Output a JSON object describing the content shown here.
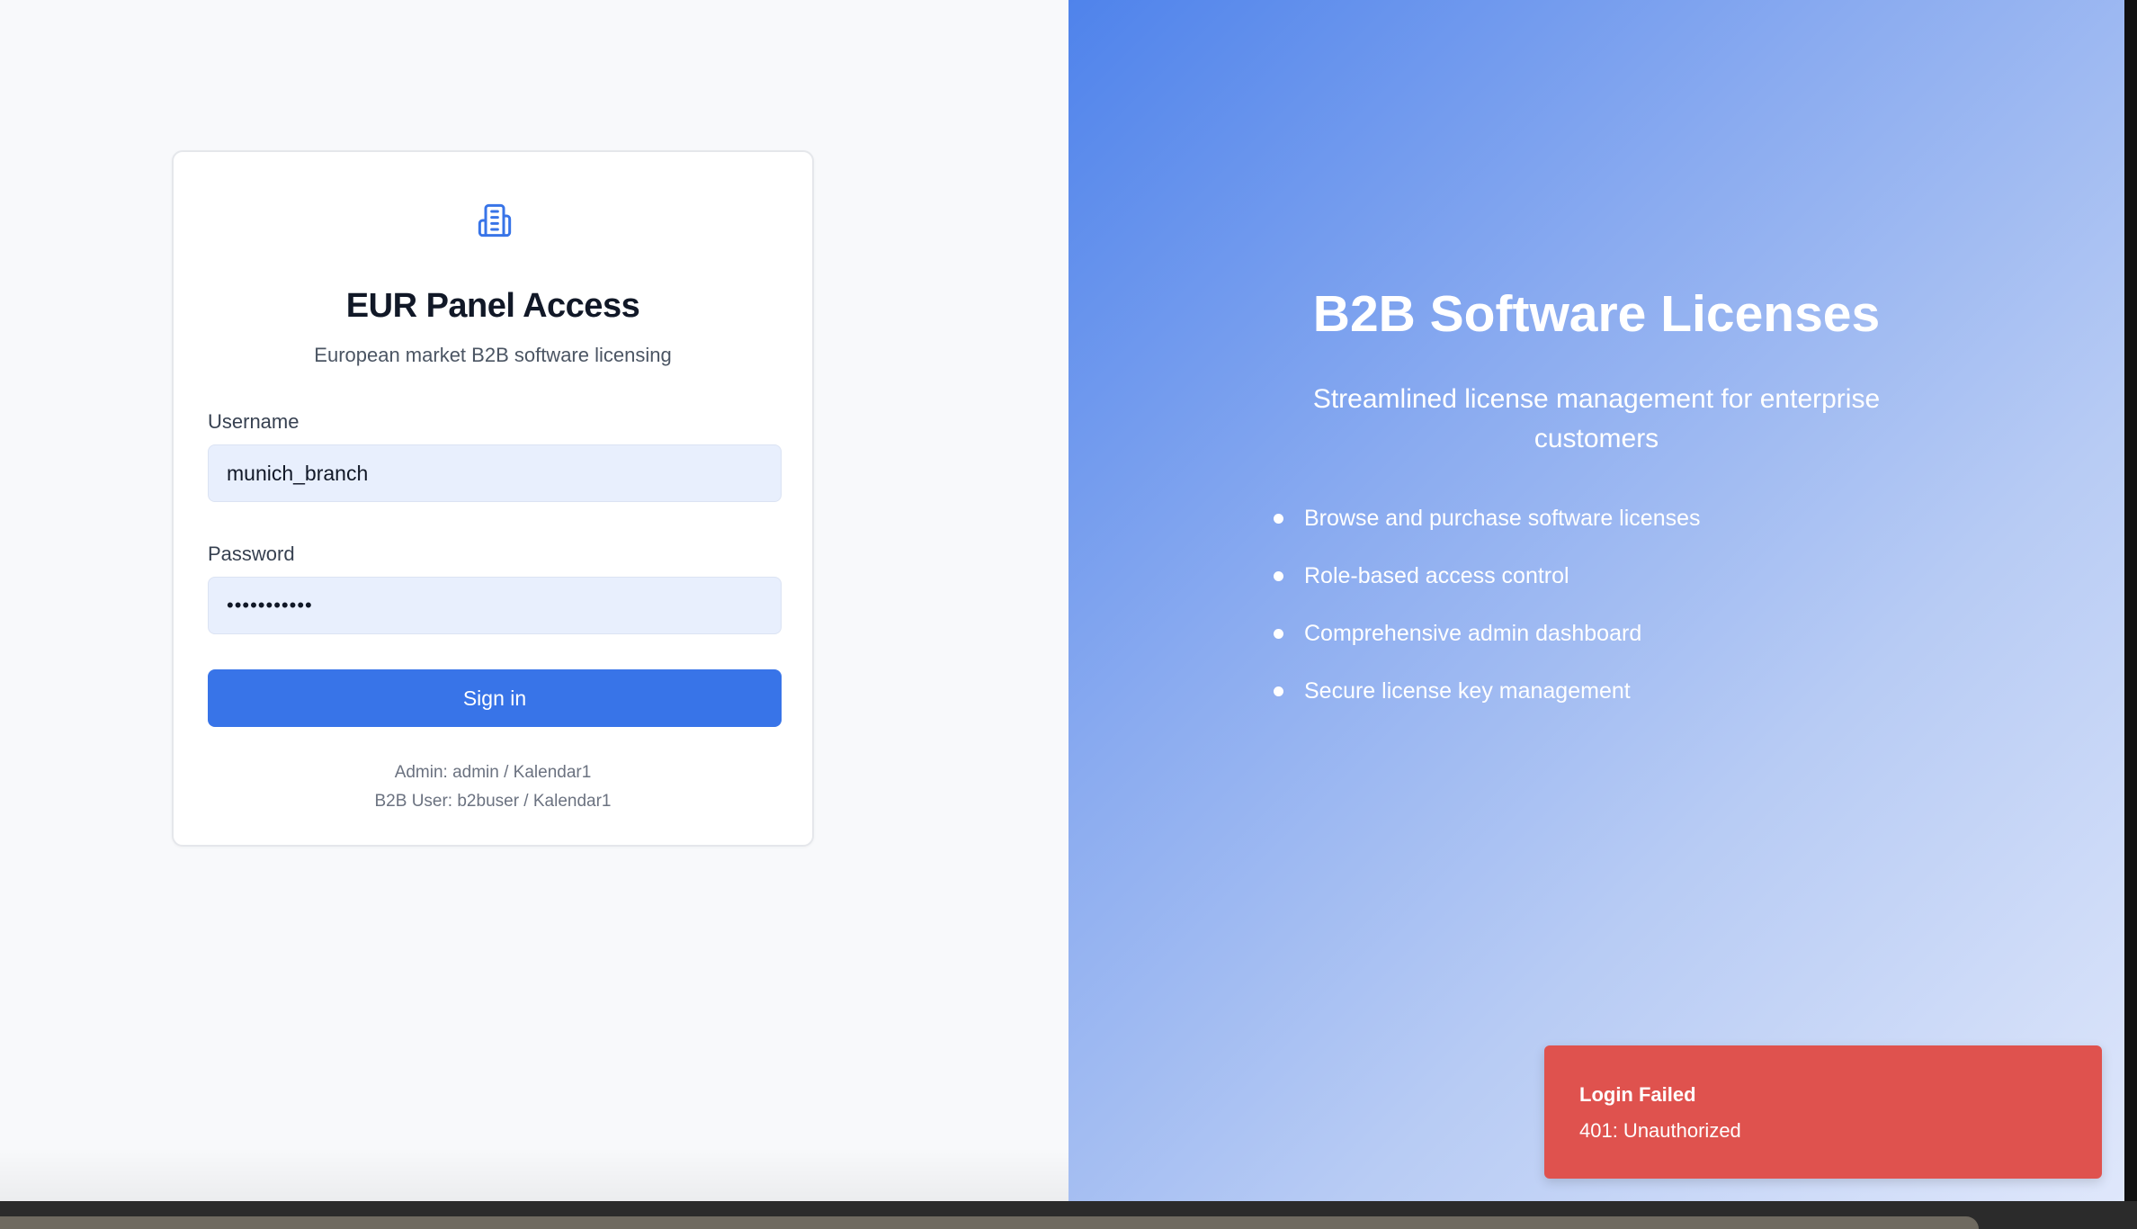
{
  "login_card": {
    "icon": "building-icon",
    "title": "EUR Panel Access",
    "subtitle": "European market B2B software licensing",
    "username_label": "Username",
    "username_value": "munich_branch",
    "password_label": "Password",
    "password_value": "•••••••••••",
    "signin_label": "Sign in",
    "hints": [
      "Admin: admin / Kalendar1",
      "B2B User: b2buser / Kalendar1"
    ]
  },
  "hero": {
    "title": "B2B Software Licenses",
    "subtitle": "Streamlined license management for enterprise customers",
    "features": [
      "Browse and purchase software licenses",
      "Role-based access control",
      "Comprehensive admin dashboard",
      "Secure license key management"
    ]
  },
  "toast": {
    "title": "Login Failed",
    "message": "401: Unauthorized"
  },
  "colors": {
    "accent": "#3874e8",
    "toast_error": "#df524e",
    "input_background": "#e8effd",
    "hero_gradient_start": "#4f83eb",
    "hero_gradient_end": "#dfe7fb"
  }
}
